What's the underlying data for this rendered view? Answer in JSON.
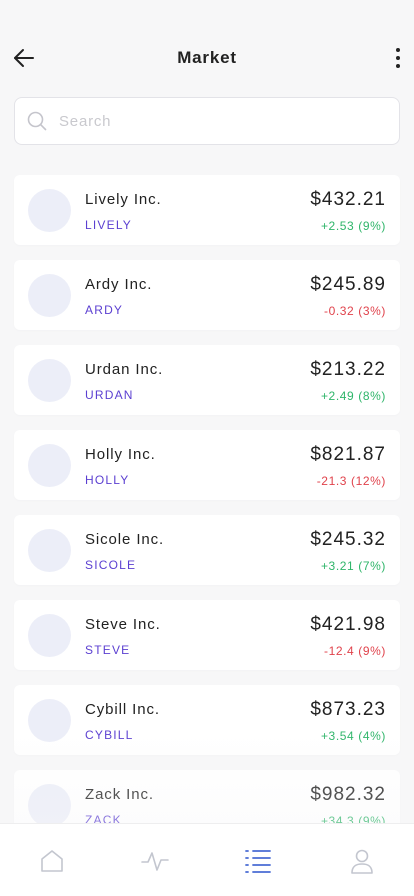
{
  "header": {
    "title": "Market"
  },
  "search": {
    "placeholder": "Search",
    "value": ""
  },
  "colors": {
    "ticker": "#5b3fd1",
    "gain": "#2fb56a",
    "loss": "#e0424b",
    "tab_active": "#4a6cd4",
    "tab_inactive": "#c3c6cf",
    "avatar": "#eceef8"
  },
  "stocks": [
    {
      "name": "Lively Inc.",
      "ticker": "LIVELY",
      "price": "$432.21",
      "change": "+2.53 (9%)",
      "direction": "up"
    },
    {
      "name": "Ardy Inc.",
      "ticker": "ARDY",
      "price": "$245.89",
      "change": "-0.32 (3%)",
      "direction": "down"
    },
    {
      "name": "Urdan Inc.",
      "ticker": "URDAN",
      "price": "$213.22",
      "change": "+2.49 (8%)",
      "direction": "up"
    },
    {
      "name": "Holly Inc.",
      "ticker": "HOLLY",
      "price": "$821.87",
      "change": "-21.3 (12%)",
      "direction": "down"
    },
    {
      "name": "Sicole Inc.",
      "ticker": "SICOLE",
      "price": "$245.32",
      "change": "+3.21 (7%)",
      "direction": "up"
    },
    {
      "name": "Steve Inc.",
      "ticker": "STEVE",
      "price": "$421.98",
      "change": "-12.4 (9%)",
      "direction": "down"
    },
    {
      "name": "Cybill Inc.",
      "ticker": "CYBILL",
      "price": "$873.23",
      "change": "+3.54 (4%)",
      "direction": "up"
    },
    {
      "name": "Zack Inc.",
      "ticker": "ZACK",
      "price": "$982.32",
      "change": "+34.3 (9%)",
      "direction": "up"
    }
  ],
  "tabbar": {
    "items": [
      {
        "icon": "home-icon",
        "active": false
      },
      {
        "icon": "activity-icon",
        "active": false
      },
      {
        "icon": "list-icon",
        "active": true
      },
      {
        "icon": "user-icon",
        "active": false
      }
    ]
  }
}
